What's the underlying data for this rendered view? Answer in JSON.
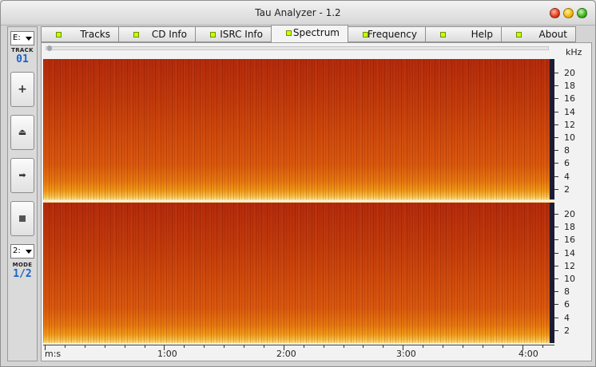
{
  "window": {
    "title": "Tau Analyzer - 1.2"
  },
  "sidebar": {
    "drive": "E:",
    "track_label": "TRACK",
    "track_number": "01",
    "buttons": [
      "add",
      "eject",
      "next",
      "stop"
    ],
    "mode_select": "2:",
    "mode_label": "MODE",
    "mode_value": "1/2"
  },
  "tabs": [
    {
      "label": "Tracks"
    },
    {
      "label": "CD Info"
    },
    {
      "label": "ISRC Info"
    },
    {
      "label": "Spectrum",
      "active": true
    },
    {
      "label": "Frequency"
    },
    {
      "label": "Help"
    },
    {
      "label": "About"
    }
  ],
  "spectrum": {
    "channels": 2,
    "y_unit": "kHz",
    "y_ticks": [
      "20",
      "18",
      "16",
      "14",
      "12",
      "10",
      "8",
      "6",
      "4",
      "2"
    ],
    "x_unit": "m:s",
    "x_ticks": [
      "1:00",
      "2:00",
      "3:00",
      "4:00"
    ],
    "colors": {
      "low": "#ffe08a",
      "mid": "#d9580e",
      "high": "#b32a0b"
    }
  },
  "icons": {
    "add": "plus-icon",
    "eject": "eject-icon",
    "next": "arrow-right-icon",
    "stop": "stop-icon"
  }
}
